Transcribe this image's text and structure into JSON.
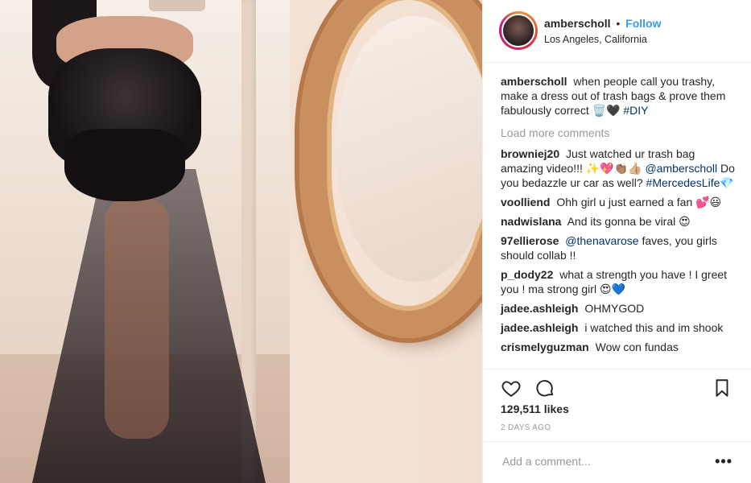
{
  "post": {
    "username": "amberscholl",
    "follow_label": "Follow",
    "separator": "•",
    "location": "Los Angeles, California"
  },
  "caption": {
    "username": "amberscholl",
    "text": "when people call you trashy, make a dress out of trash bags & prove them fabulously correct 🗑️🖤",
    "hashtag": "#DIY"
  },
  "load_more_label": "Load more comments",
  "comments": [
    {
      "user": "browniej20",
      "text": "Just watched ur trash bag amazing video!!! ✨💖👏🏽👍🏼",
      "mention": "@amberscholl",
      "text_after": "Do you bedazzle ur car as well?",
      "hashtag": "#MercedesLife💎"
    },
    {
      "user": "voolliend",
      "text": "Ohh girl u just earned a fan 💕😃"
    },
    {
      "user": "nadwislana",
      "text": "And its gonna be viral 😍"
    },
    {
      "user": "97ellierose",
      "mention": "@thenavarose",
      "text": "faves, you girls should collab !!"
    },
    {
      "user": "p_dody22",
      "text": "what a strength you have ! I greet you ! ma strong girl 😍💙"
    },
    {
      "user": "jadee.ashleigh",
      "text": "OHMYGOD"
    },
    {
      "user": "jadee.ashleigh",
      "text": "i watched this and im shook"
    },
    {
      "user": "crismelyguzman",
      "text": "Wow con fundas"
    }
  ],
  "likes": "129,511 likes",
  "time_ago": "2 DAYS AGO",
  "add_comment_placeholder": "Add a comment...",
  "more_label": "•••",
  "icons": {
    "like": "heart-icon",
    "comment": "comment-bubble-icon",
    "save": "bookmark-icon"
  }
}
